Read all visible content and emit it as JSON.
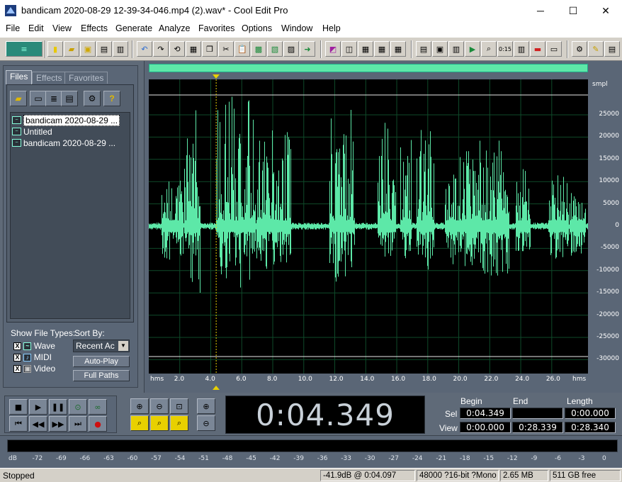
{
  "window": {
    "title": "bandicam 2020-08-29 12-39-34-046.mp4 (2).wav* - Cool Edit Pro",
    "minimize": "─",
    "maximize": "☐",
    "close": "✕"
  },
  "menu": [
    "File",
    "Edit",
    "View",
    "Effects",
    "Generate",
    "Analyze",
    "Favorites",
    "Options",
    "Window",
    "Help"
  ],
  "left_panel": {
    "tabs": [
      "Files",
      "Effects",
      "Favorites"
    ],
    "active_tab": "Files",
    "files": [
      {
        "name": "bandicam 2020-08-29 ...",
        "selected": true
      },
      {
        "name": "Untitled",
        "selected": false
      },
      {
        "name": "bandicam 2020-08-29 ...",
        "selected": false
      }
    ],
    "show_file_types_label": "Show File Types:",
    "file_types": [
      {
        "label": "Wave",
        "checked": true
      },
      {
        "label": "MIDI",
        "checked": true
      },
      {
        "label": "Video",
        "checked": true
      }
    ],
    "sort_by_label": "Sort By:",
    "sort_by_value": "Recent Ac",
    "auto_play_label": "Auto-Play",
    "full_paths_label": "Full Paths"
  },
  "waveform": {
    "amplitude_unit": "smpl",
    "amplitude_labels": [
      "25000",
      "20000",
      "15000",
      "10000",
      "5000",
      "0",
      "-5000",
      "-10000",
      "-15000",
      "-20000",
      "-25000",
      "-30000"
    ],
    "time_unit": "hms",
    "time_labels": [
      "2.0",
      "4.0",
      "6.0",
      "8.0",
      "10.0",
      "12.0",
      "14.0",
      "16.0",
      "18.0",
      "20.0",
      "22.0",
      "24.0",
      "26.0"
    ],
    "wave_color": "#5de8a8",
    "cursor_time": 4.349
  },
  "transport": {
    "current_time": "0:04.349"
  },
  "selection": {
    "headers": [
      "Begin",
      "End",
      "Length"
    ],
    "sel_label": "Sel",
    "view_label": "View",
    "sel": {
      "begin": "0:04.349",
      "end": "",
      "length": "0:00.000"
    },
    "view": {
      "begin": "0:00.000",
      "end": "0:28.339",
      "length": "0:28.340"
    }
  },
  "level_meter": {
    "labels": [
      "dB",
      "-72",
      "-69",
      "-66",
      "-63",
      "-60",
      "-57",
      "-54",
      "-51",
      "-48",
      "-45",
      "-42",
      "-39",
      "-36",
      "-33",
      "-30",
      "-27",
      "-24",
      "-21",
      "-18",
      "-15",
      "-12",
      "-9",
      "-6",
      "-3",
      "0"
    ]
  },
  "status": {
    "state": "Stopped",
    "level_at": "-41.9dB @  0:04.097",
    "format": "48000 ?16-bit ?Mono",
    "size": "2.65 MB",
    "free": "511 GB free"
  }
}
